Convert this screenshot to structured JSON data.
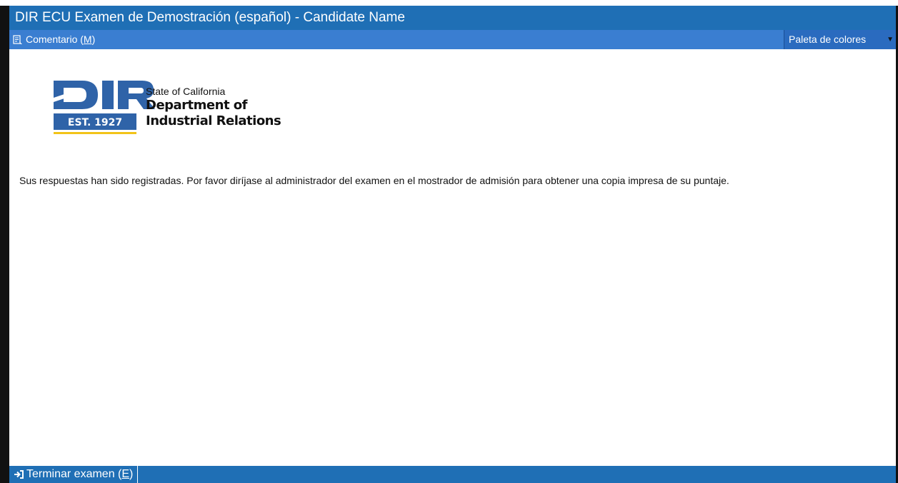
{
  "window": {
    "title": "DIR ECU Examen de Demostración (español) - Candidate Name"
  },
  "toolbar": {
    "comment_label": "Comentario (",
    "comment_key": "M",
    "comment_suffix": ")",
    "comment_icon": "comment-note-icon",
    "palette_label": "Paleta de colores",
    "palette_arrow": "▼"
  },
  "logo": {
    "letters": "DIR",
    "est": "EST. 1927",
    "line1": "State of California",
    "line2": "Department of",
    "line3": "Industrial Relations",
    "colors": {
      "blue": "#2f63a8",
      "gold": "#f2c318"
    }
  },
  "main": {
    "message": "Sus respuestas han sido registradas. Por favor diríjase al administrador del examen en el mostrador de admisión para obtener una copia impresa de su puntaje."
  },
  "footer": {
    "finish_label": "Terminar examen (",
    "finish_key": "E",
    "finish_suffix": ")",
    "finish_icon": "exit-icon"
  },
  "colors": {
    "title_bar": "#1f6fb5",
    "toolbar": "#3a7ed1",
    "footer": "#1f6fb5"
  }
}
